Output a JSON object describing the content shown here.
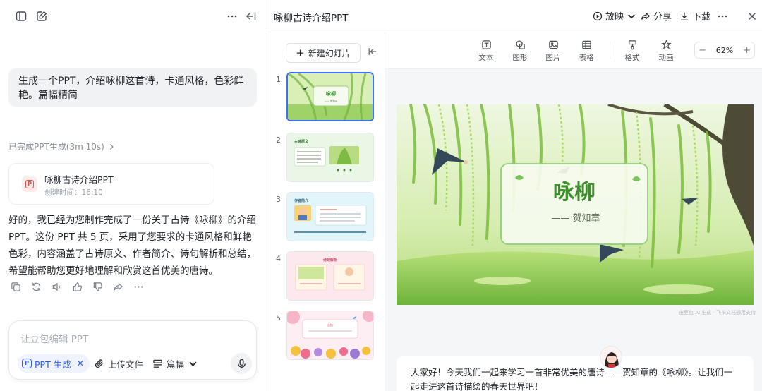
{
  "chat": {
    "prompt": "生成一个PPT，介绍咏柳这首诗，卡通风格，色彩鲜艳。篇幅精简",
    "done_label": "已完成PPT生成(3m 10s)",
    "file": {
      "name": "咏柳古诗介绍PPT",
      "time": "创建时间：16:10"
    },
    "answer": "好的，我已经为您制作完成了一份关于古诗《咏柳》的介绍 PPT。这份 PPT 共 5 页，采用了您要求的卡通风格和鲜艳色彩，内容涵盖了古诗原文、作者简介、诗句解析和总结，希望能帮助您更好地理解和欣赏这首优美的唐诗。",
    "composer": {
      "placeholder": "让豆包编辑 PPT",
      "chip": "PPT 生成",
      "upload": "上传文件",
      "length": "篇幅"
    }
  },
  "header": {
    "title": "咏柳古诗介绍PPT",
    "play": "放映",
    "share": "分享",
    "download": "下载"
  },
  "thumbnails": {
    "new_slide": "新建幻灯片",
    "items": [
      {
        "num": "1",
        "title": "咏柳",
        "sub": "—— 贺知章"
      },
      {
        "num": "2",
        "title": "古诗原文"
      },
      {
        "num": "3",
        "title": "作者简介"
      },
      {
        "num": "4",
        "title": "诗句解析"
      },
      {
        "num": "5",
        "title": "总结"
      }
    ]
  },
  "toolbar": {
    "text": "文本",
    "shape": "图形",
    "image": "图片",
    "table": "表格",
    "format": "格式",
    "animation": "动画",
    "zoom": "62%"
  },
  "slide": {
    "title": "咏柳",
    "author": "—— 贺知章"
  },
  "watermark": "由豆包 AI 生成 · 飞书文档通用支持",
  "notes": "大家好！今天我们一起来学习一首非常优美的唐诗——贺知章的《咏柳》。让我们一起走进这首诗描绘的春天世界吧！"
}
